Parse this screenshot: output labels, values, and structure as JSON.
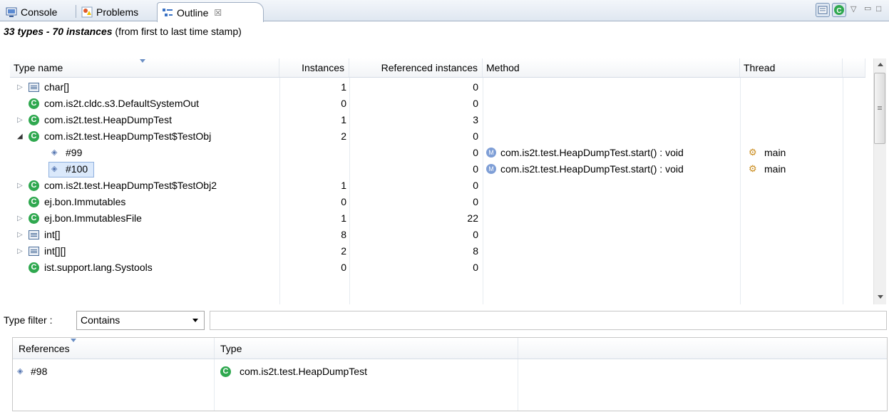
{
  "tabs": [
    {
      "label": "Console",
      "icon": "console-icon"
    },
    {
      "label": "Problems",
      "icon": "problems-icon"
    },
    {
      "label": "Outline",
      "icon": "outline-icon",
      "close": "☒"
    }
  ],
  "summary": {
    "bold": "33 types - 70 instances",
    "rest": " (from first to last time stamp)"
  },
  "columns": [
    "Type name",
    "Instances",
    "Referenced instances",
    "Method",
    "Thread"
  ],
  "rows": [
    {
      "name": "char[]",
      "instances": "1",
      "referenced": "0",
      "method": "",
      "thread": ""
    },
    {
      "name": "com.is2t.cldc.s3.DefaultSystemOut",
      "instances": "0",
      "referenced": "0",
      "method": "",
      "thread": ""
    },
    {
      "name": "com.is2t.test.HeapDumpTest",
      "instances": "1",
      "referenced": "3",
      "method": "",
      "thread": ""
    },
    {
      "name": "com.is2t.test.HeapDumpTest$TestObj",
      "instances": "2",
      "referenced": "0",
      "method": "",
      "thread": ""
    },
    {
      "name": "#99",
      "instances": "",
      "referenced": "0",
      "method": "com.is2t.test.HeapDumpTest.start() : void",
      "thread": "main"
    },
    {
      "name": "#100",
      "instances": "",
      "referenced": "0",
      "method": "com.is2t.test.HeapDumpTest.start() : void",
      "thread": "main"
    },
    {
      "name": "com.is2t.test.HeapDumpTest$TestObj2",
      "instances": "1",
      "referenced": "0",
      "method": "",
      "thread": ""
    },
    {
      "name": "ej.bon.Immutables",
      "instances": "0",
      "referenced": "0",
      "method": "",
      "thread": ""
    },
    {
      "name": "ej.bon.ImmutablesFile",
      "instances": "1",
      "referenced": "22",
      "method": "",
      "thread": ""
    },
    {
      "name": "int[]",
      "instances": "8",
      "referenced": "0",
      "method": "",
      "thread": ""
    },
    {
      "name": "int[][]",
      "instances": "2",
      "referenced": "8",
      "method": "",
      "thread": ""
    },
    {
      "name": "ist.support.lang.Systools",
      "instances": "0",
      "referenced": "0",
      "method": "",
      "thread": ""
    }
  ],
  "filter": {
    "label": "Type filter :",
    "mode": "Contains",
    "value": ""
  },
  "bottom": {
    "columns": [
      "References",
      "Type"
    ],
    "rows": [
      {
        "ref": "#98",
        "type": "com.is2t.test.HeapDumpTest"
      }
    ]
  }
}
